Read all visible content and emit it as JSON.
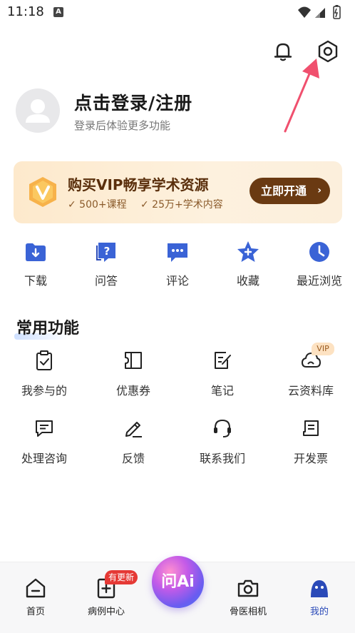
{
  "status_bar": {
    "time": "11:18",
    "indicator": "A"
  },
  "profile": {
    "title": "点击登录/注册",
    "subtitle": "登录后体验更多功能"
  },
  "vip": {
    "title": "购买VIP畅享学术资源",
    "feature1": "✓ 500+课程",
    "feature2": "✓ 25万+学术内容",
    "button_label": "立即开通",
    "button_chevron": "›"
  },
  "quick_actions": [
    {
      "label": "下载",
      "icon": "download-folder-icon"
    },
    {
      "label": "问答",
      "icon": "question-icon"
    },
    {
      "label": "评论",
      "icon": "comment-icon"
    },
    {
      "label": "收藏",
      "icon": "star-icon"
    },
    {
      "label": "最近浏览",
      "icon": "clock-icon"
    }
  ],
  "section": {
    "title": "常用功能"
  },
  "functions": [
    {
      "label": "我参与的",
      "icon": "clipboard-check-icon"
    },
    {
      "label": "优惠券",
      "icon": "coupon-icon"
    },
    {
      "label": "笔记",
      "icon": "note-edit-icon"
    },
    {
      "label": "云资料库",
      "icon": "cloud-icon",
      "tag": "VIP"
    },
    {
      "label": "处理咨询",
      "icon": "message-icon"
    },
    {
      "label": "反馈",
      "icon": "pen-icon"
    },
    {
      "label": "联系我们",
      "icon": "headset-icon"
    },
    {
      "label": "开发票",
      "icon": "invoice-icon"
    }
  ],
  "bottom_nav": {
    "items": [
      {
        "label": "首页",
        "icon": "home-icon"
      },
      {
        "label": "病例中心",
        "icon": "case-add-icon",
        "badge": "有更新"
      },
      {
        "label": "骨医相机",
        "icon": "camera-icon"
      },
      {
        "label": "我的",
        "icon": "profile-icon",
        "active": true
      }
    ],
    "ai_label": "问Ai"
  },
  "colors": {
    "accent": "#2a4ab8",
    "vip_brown": "#6a3a12",
    "arrow_red": "#f0506e",
    "badge_red": "#e53935"
  }
}
